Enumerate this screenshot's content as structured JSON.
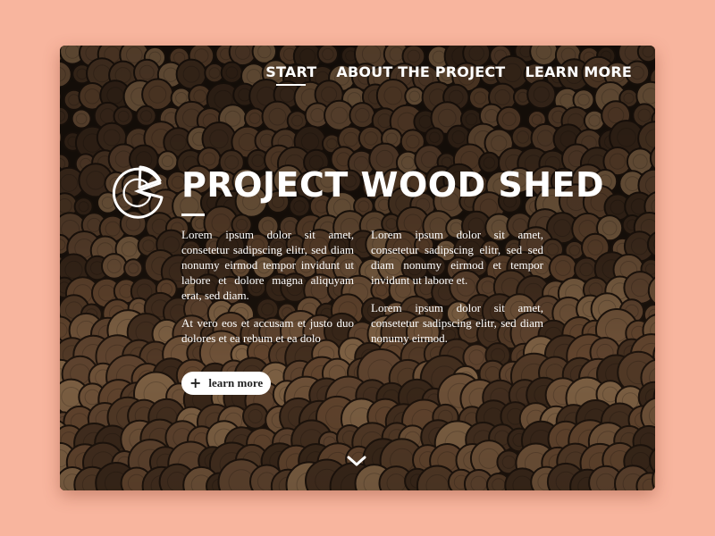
{
  "nav": {
    "items": [
      {
        "label": "Start",
        "active": true
      },
      {
        "label": "About the Project",
        "active": false
      },
      {
        "label": "Learn More",
        "active": false
      }
    ]
  },
  "hero": {
    "logo_icon": "pie-logo-icon",
    "title": "Project Wood Shed",
    "left_paragraphs": [
      "Lorem ipsum dolor sit amet, consetetur sadipscing elitr, sed diam nonumy eirmod tempor invidunt ut labore et dolore magna aliquyam erat, sed diam.",
      "At vero eos et accusam et justo duo dolores et ea rebum et ea dolo"
    ],
    "right_paragraphs": [
      "Lorem ipsum dolor sit amet, consetetur sadipscing elitr, sed sed diam nonumy eirmod et tempor invidunt ut labore et.",
      "Lorem ipsum dolor sit amet, consetetur sadipscing elitr, sed diam nonumy eirmod."
    ],
    "button": {
      "label": "learn more",
      "icon": "plus-icon"
    },
    "scroll_icon": "chevron-down-icon"
  },
  "colors": {
    "page_background": "#f8b59e",
    "text": "#ffffff",
    "wood_dark": "#241911"
  }
}
